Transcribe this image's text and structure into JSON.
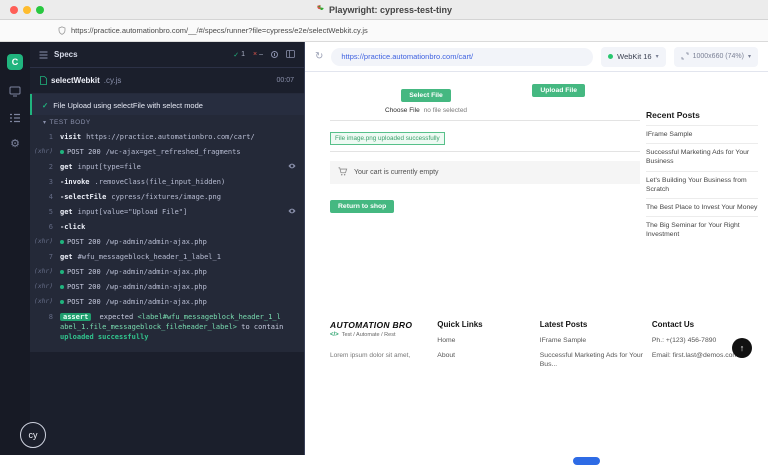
{
  "colors": {
    "accent_green": "#20b47e",
    "button_green": "#45b881",
    "fail_red": "#e4574d",
    "link_blue": "#3f62e0",
    "reporter_bg": "#1b1f2c"
  },
  "chrome": {
    "window_title": "Playwright: cypress-test-tiny",
    "address_url": "https://practice.automationbro.com/__/#/specs/runner?file=cypress/e2e/selectWebkit.cy.js"
  },
  "reporter": {
    "specs_label": "Specs",
    "stats": {
      "passed": "1"
    },
    "spec_name": "selectWebkit",
    "spec_ext": ".cy.js",
    "duration": "00:07",
    "test_title": "File Upload using selectFile with select mode",
    "section_label": "TEST BODY",
    "commands": [
      {
        "type": "cmd",
        "num": "1",
        "name": "visit",
        "args": "https://practice.automationbro.com/cart/"
      },
      {
        "type": "xhr",
        "num": "(xhr)",
        "name": "POST 200",
        "args": "/wc-ajax=get_refreshed_fragments"
      },
      {
        "type": "cmd",
        "num": "2",
        "name": "get",
        "args": "input[type=file",
        "eye": true
      },
      {
        "type": "cmd",
        "num": "3",
        "name": "-invoke",
        "args": ".removeClass(file_input_hidden)"
      },
      {
        "type": "cmd",
        "num": "4",
        "name": "-selectFile",
        "args": "cypress/fixtures/image.png"
      },
      {
        "type": "cmd",
        "num": "5",
        "name": "get",
        "args": "input[value=\"Upload File\"]",
        "eye": true
      },
      {
        "type": "cmd",
        "num": "6",
        "name": "-click",
        "args": ""
      },
      {
        "type": "xhr",
        "num": "(xhr)",
        "name": "POST 200",
        "args": "/wp-admin/admin-ajax.php"
      },
      {
        "type": "cmd",
        "num": "7",
        "name": "get",
        "args": "#wfu_messageblock_header_1_label_1"
      },
      {
        "type": "xhr",
        "num": "(xhr)",
        "name": "POST 200",
        "args": "/wp-admin/admin-ajax.php"
      },
      {
        "type": "xhr",
        "num": "(xhr)",
        "name": "POST 200",
        "args": "/wp-admin/admin-ajax.php"
      },
      {
        "type": "xhr",
        "num": "(xhr)",
        "name": "POST 200",
        "args": "/wp-admin/admin-ajax.php"
      }
    ],
    "assert": {
      "num": "8",
      "badge": "assert",
      "expected": "expected",
      "selector": "<label#wfu_messageblock_header_1_label_1.file_messageblock_fileheader_label>",
      "middle": "to contain",
      "value": "uploaded successfully"
    }
  },
  "aut": {
    "url": "https://practice.automationbro.com/cart/",
    "browser": "WebKit 16",
    "viewport": "1000x660 (74%)",
    "page": {
      "select_file_button": "Select File",
      "choose_file_label": "Choose File",
      "no_file_text": "no file selected",
      "upload_file_button": "Upload File",
      "success_message": "File image.png uploaded successfully",
      "cart_notice": "Your cart is currently empty",
      "return_button": "Return to shop",
      "recent_posts_title": "Recent Posts",
      "recent_posts": [
        "IFrame Sample",
        "Successful Marketing Ads for Your Business",
        "Let's Building Your Business from Scratch",
        "The Best Place to Invest Your Money",
        "The Big Seminar for Your Right Investment"
      ],
      "footer": {
        "brand": "AUTOMATION BRO",
        "brand_icon": "</>",
        "tagline": "Test / Automate / Rest",
        "lorem": "Lorem ipsum dolor sit amet,",
        "quick_links_title": "Quick Links",
        "quick_links": [
          "Home",
          "About"
        ],
        "latest_posts_title": "Latest Posts",
        "latest_posts": [
          "IFrame Sample",
          "Successful Marketing Ads for Your Bus..."
        ],
        "contact_title": "Contact Us",
        "phone": "Ph.: +(123) 456-7890",
        "email": "Email: first.last@demos.com"
      }
    }
  }
}
